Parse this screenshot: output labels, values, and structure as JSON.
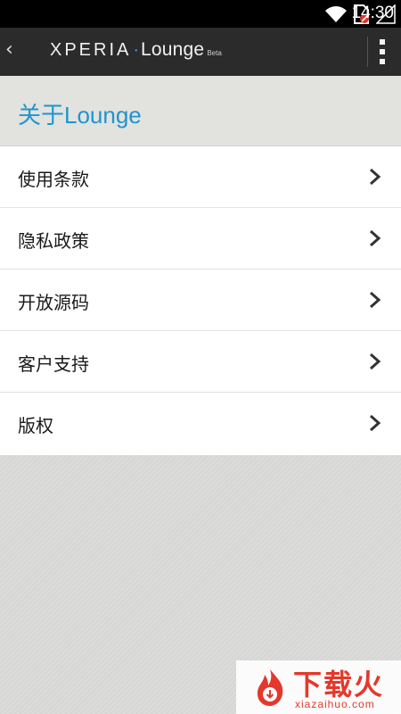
{
  "status_bar": {
    "time": "14:30",
    "icons": [
      "wifi-icon",
      "no-sim-icon",
      "signal-icon",
      "battery-icon"
    ]
  },
  "app_bar": {
    "back_glyph": "‹",
    "brand_name": "XPERIA",
    "brand_separator": "·",
    "brand_product": "Lounge",
    "brand_tag": "Beta"
  },
  "page": {
    "title": "关于Lounge"
  },
  "menu": {
    "items": [
      {
        "label": "使用条款"
      },
      {
        "label": "隐私政策"
      },
      {
        "label": "开放源码"
      },
      {
        "label": "客户支持"
      },
      {
        "label": "版权"
      }
    ]
  },
  "watermark": {
    "title": "下载火",
    "url": "xiazaihuo.com"
  },
  "colors": {
    "accent": "#1f95cf",
    "app_bar": "#2b2b2b",
    "status_bar": "#000000",
    "header_band": "#e2e2df",
    "watermark": "#e4382c"
  }
}
